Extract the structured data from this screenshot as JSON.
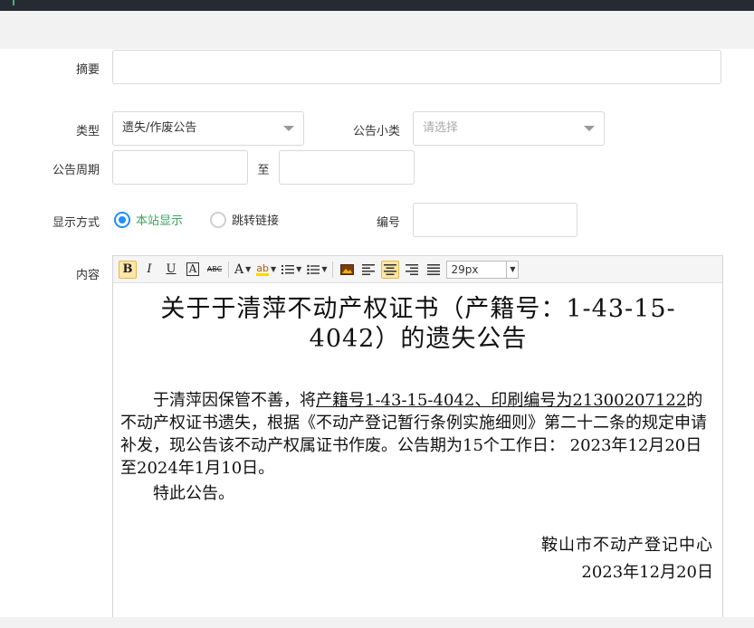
{
  "form": {
    "summary": {
      "label": "摘要",
      "value": ""
    },
    "type": {
      "label": "类型",
      "value": "遗失/作废公告"
    },
    "subcategory": {
      "label": "公告小类",
      "placeholder": "请选择"
    },
    "period": {
      "label": "公告周期",
      "start": "",
      "separator": "至",
      "end": ""
    },
    "display": {
      "label": "显示方式",
      "options": [
        "本站显示",
        "跳转链接"
      ],
      "selected": "本站显示"
    },
    "number": {
      "label": "编号",
      "value": ""
    },
    "content": {
      "label": "内容"
    }
  },
  "toolbar": {
    "bold": "B",
    "italic": "I",
    "underline": "U",
    "boxed": "A",
    "strike": "ABC",
    "font_color": "A",
    "highlight": "ab",
    "font_size": "29px",
    "active_align": "center"
  },
  "document": {
    "title": "关于于清萍不动产权证书（产籍号：1-43-15-4042）的遗失公告",
    "para_before": "于清萍因保管不善，将",
    "para_underlined": "产籍号1-43-15-4042、印刷编号为21300207122",
    "para_after": "的不动产权证书遗失，根据《不动产登记暂行条例实施细则》第二十二条的规定申请补发，现公告该不动产权属证书作废。公告期为15个工作日： 2023年12月20日至2024年1月10日。",
    "closing": "特此公告。",
    "organization": "鞍山市不动产登记中心",
    "date": "2023年12月20日"
  }
}
